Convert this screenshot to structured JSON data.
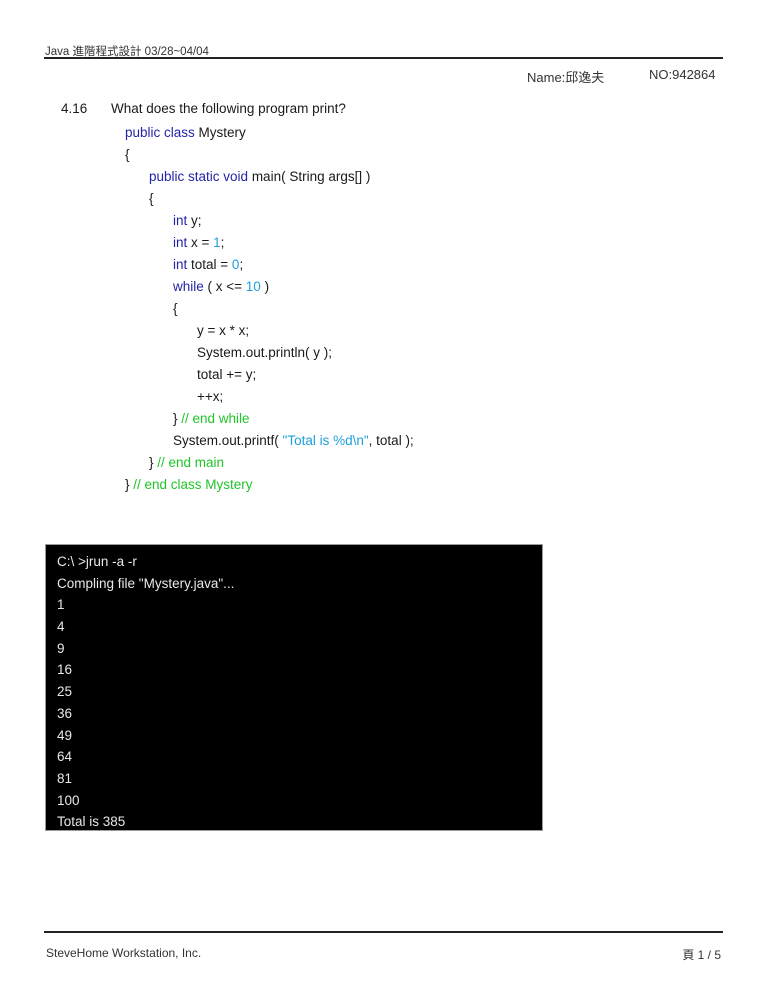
{
  "header": {
    "course_title": "Java 進階程式設計 03/28~04/04",
    "name_label": "Name:邱逸夫",
    "number_label": "NO:942864"
  },
  "question": {
    "number": "4.16",
    "prompt": "What does the following program print?"
  },
  "code": {
    "colors": {
      "keyword": "#2424a8",
      "literal": "#1e9fdc",
      "comment": "#22c42a",
      "text": "#1a1a1a"
    },
    "lines": [
      {
        "indent": 0,
        "tokens": [
          {
            "t": "kw",
            "v": "public class"
          },
          {
            "t": "tx",
            "v": " Mystery"
          }
        ]
      },
      {
        "indent": 0,
        "tokens": [
          {
            "t": "tx",
            "v": "{"
          }
        ]
      },
      {
        "indent": 1,
        "tokens": [
          {
            "t": "kw",
            "v": "public static void"
          },
          {
            "t": "tx",
            "v": " main( String args[] )"
          }
        ]
      },
      {
        "indent": 1,
        "tokens": [
          {
            "t": "tx",
            "v": "{"
          }
        ]
      },
      {
        "indent": 2,
        "tokens": [
          {
            "t": "kw",
            "v": "int"
          },
          {
            "t": "tx",
            "v": " y;"
          }
        ]
      },
      {
        "indent": 2,
        "tokens": [
          {
            "t": "kw",
            "v": "int"
          },
          {
            "t": "tx",
            "v": " x = "
          },
          {
            "t": "lit",
            "v": "1"
          },
          {
            "t": "tx",
            "v": ";"
          }
        ]
      },
      {
        "indent": 2,
        "tokens": [
          {
            "t": "kw",
            "v": "int"
          },
          {
            "t": "tx",
            "v": " total = "
          },
          {
            "t": "lit",
            "v": "0"
          },
          {
            "t": "tx",
            "v": ";"
          }
        ]
      },
      {
        "indent": 2,
        "tokens": [
          {
            "t": "kw",
            "v": "while"
          },
          {
            "t": "tx",
            "v": " ( x <= "
          },
          {
            "t": "lit",
            "v": "10"
          },
          {
            "t": "tx",
            "v": " )"
          }
        ]
      },
      {
        "indent": 2,
        "tokens": [
          {
            "t": "tx",
            "v": "{"
          }
        ]
      },
      {
        "indent": 3,
        "tokens": [
          {
            "t": "tx",
            "v": "y = x * x;"
          }
        ]
      },
      {
        "indent": 3,
        "tokens": [
          {
            "t": "tx",
            "v": "System.out.println( y );"
          }
        ]
      },
      {
        "indent": 3,
        "tokens": [
          {
            "t": "tx",
            "v": "total += y;"
          }
        ]
      },
      {
        "indent": 3,
        "tokens": [
          {
            "t": "tx",
            "v": "++x;"
          }
        ]
      },
      {
        "indent": 2,
        "tokens": [
          {
            "t": "tx",
            "v": "} "
          },
          {
            "t": "cm",
            "v": "// end while"
          }
        ]
      },
      {
        "indent": 2,
        "tokens": [
          {
            "t": "tx",
            "v": "System.out.printf( "
          },
          {
            "t": "lit",
            "v": "\"Total is %d\\n\""
          },
          {
            "t": "tx",
            "v": ", total );"
          }
        ]
      },
      {
        "indent": 1,
        "tokens": [
          {
            "t": "tx",
            "v": "} "
          },
          {
            "t": "cm",
            "v": "// end main"
          }
        ]
      },
      {
        "indent": 0,
        "tokens": [
          {
            "t": "tx",
            "v": "} "
          },
          {
            "t": "cm",
            "v": "// end class Mystery"
          }
        ]
      }
    ]
  },
  "terminal": {
    "lines": [
      "C:\\ >jrun -a -r",
      "Compling file \"Mystery.java\"...",
      "1",
      "4",
      "9",
      "16",
      "25",
      "36",
      "49",
      "64",
      "81",
      "100",
      "Total is 385"
    ]
  },
  "footer": {
    "company": "SteveHome Workstation, Inc.",
    "page_indicator": "頁 1 / 5"
  }
}
